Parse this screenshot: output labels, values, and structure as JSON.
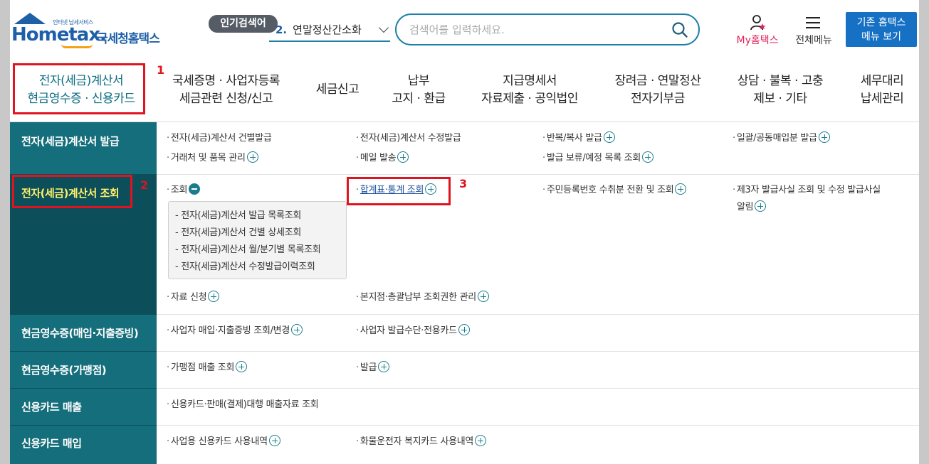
{
  "logo": {
    "sub": "인터넷 납세서비스",
    "main": "Hometax.",
    "kr": "국세청홈택스"
  },
  "header": {
    "popular_label": "인기검색어",
    "popular_num": "2.",
    "popular_text": "연말정산간소화",
    "search_placeholder": "검색어를 입력하세요.",
    "my_hometax": "My홈택스",
    "all_menu": "전체메뉴",
    "old_btn_line1": "기존 홈택스",
    "old_btn_line2": "메뉴 보기"
  },
  "topnav": [
    {
      "line1": "전자(세금)계산서",
      "line2": "현금영수증 · 신용카드"
    },
    {
      "line1": "국세증명 · 사업자등록",
      "line2": "세금관련 신청/신고"
    },
    {
      "line1": "세금신고",
      "line2": ""
    },
    {
      "line1": "납부",
      "line2": "고지 · 환급"
    },
    {
      "line1": "지급명세서",
      "line2": "자료제출 · 공익법인"
    },
    {
      "line1": "장려금 · 연말정산",
      "line2": "전자기부금"
    },
    {
      "line1": "상담 · 불복 · 고충",
      "line2": "제보 · 기타"
    },
    {
      "line1": "세무대리",
      "line2": "납세관리"
    }
  ],
  "sidebar": [
    "전자(세금)계산서 발급",
    "전자(세금)계산서 조회",
    "현금영수증(매입·지출증빙)",
    "현금영수증(가맹점)",
    "신용카드 매출",
    "신용카드 매입"
  ],
  "issue": {
    "c1a": "전자(세금)계산서 건별발급",
    "c1b": "거래처 및 품목 관리",
    "c2a": "전자(세금)계산서 수정발급",
    "c2b": "메일 발송",
    "c3a": "반복/복사 발급",
    "c3b": "발급 보류/예정 목록 조회",
    "c4a": "일괄/공동매입분 발급"
  },
  "inquiry": {
    "c1": "조회",
    "sub": [
      "전자(세금)계산서 발급 목록조회",
      "전자(세금)계산서 건별 상세조회",
      "전자(세금)계산서 월/분기별 목록조회",
      "전자(세금)계산서 수정발급이력조회"
    ],
    "c2": "합계표·통계 조회",
    "c3": "주민등록번호 수취분 전환 및 조회",
    "c4_line1": "제3자 발급사실 조회 및 수정 발급사실",
    "c4_line2": "알림",
    "c5": "자료 신청",
    "c6": "본지점·총괄납부 조회권한 관리"
  },
  "cash_buy": {
    "c1": "사업자 매입·지출증빙 조회/변경",
    "c2": "사업자 발급수단·전용카드"
  },
  "cash_shop": {
    "c1": "가맹점 매출 조회",
    "c2": "발급"
  },
  "card_sales": {
    "c1": "신용카드·판매(결제)대행 매출자료 조회"
  },
  "card_buy": {
    "c1": "사업용 신용카드 사용내역",
    "c2": "화물운전자 복지카드 사용내역"
  },
  "annotations": {
    "n1": "1",
    "n2": "2",
    "n3": "3"
  },
  "colors": {
    "sidebar": "#156e7b",
    "sidebar_active": "#0c4e59",
    "accent": "#1e7fa8",
    "highlight": "#e0141e"
  }
}
